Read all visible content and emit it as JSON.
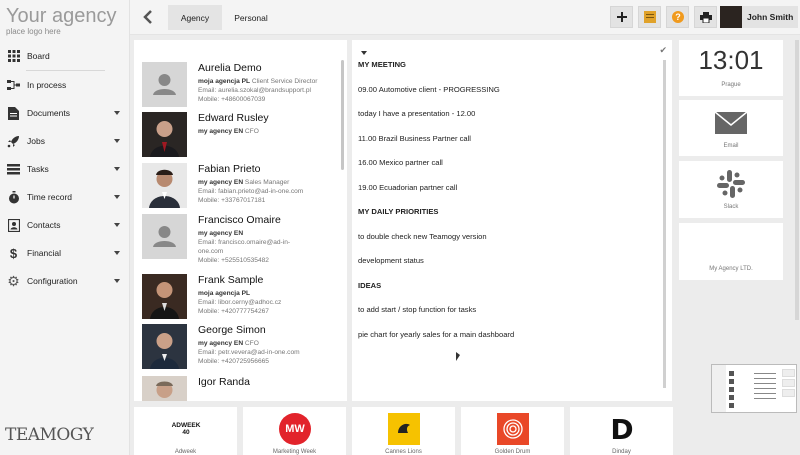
{
  "brand": {
    "title": "Your agency",
    "subtitle": "place logo here",
    "footer_logo": "TEAMOGY"
  },
  "sidebar": {
    "items": [
      {
        "label": "Board",
        "icon": "grid-icon",
        "has_caret": false
      },
      {
        "label": "In process",
        "icon": "flow-icon",
        "has_caret": false
      },
      {
        "label": "Documents",
        "icon": "document-icon",
        "has_caret": true
      },
      {
        "label": "Jobs",
        "icon": "rocket-icon",
        "has_caret": true
      },
      {
        "label": "Tasks",
        "icon": "tasks-icon",
        "has_caret": true
      },
      {
        "label": "Time record",
        "icon": "stopwatch-icon",
        "has_caret": true
      },
      {
        "label": "Contacts",
        "icon": "contact-card-icon",
        "has_caret": true
      },
      {
        "label": "Financial",
        "icon": "dollar-icon",
        "has_caret": true
      },
      {
        "label": "Configuration",
        "icon": "gear-icon",
        "has_caret": true
      }
    ]
  },
  "topbar": {
    "tabs": [
      {
        "label": "Agency",
        "active": true
      },
      {
        "label": "Personal",
        "active": false
      }
    ],
    "user_name": "John Smith"
  },
  "contacts": [
    {
      "name": "Aurelia Demo",
      "company": "moja agencja PL",
      "role": "Client Service Director",
      "lines": [
        "Email: aurelia.szokal@brandsupport.pl",
        "Mobile: +48600067039"
      ],
      "photo": "placeholder"
    },
    {
      "name": "Edward Rusley",
      "company": "my agency EN",
      "role": "CFO",
      "lines": [],
      "photo": "portrait"
    },
    {
      "name": "Fabian Prieto",
      "company": "my agency EN",
      "role": "Sales Manager",
      "lines": [
        "Email: fabian.prieto@ad-in-one.com",
        "Mobile: +33767017181"
      ],
      "photo": "portrait"
    },
    {
      "name": "Francisco Omaire",
      "company": "my agency EN",
      "role": "",
      "lines": [
        "Email: francisco.omaire@ad-in-",
        "one.com",
        "Mobile: +525510535482"
      ],
      "photo": "placeholder"
    },
    {
      "name": "Frank Sample",
      "company": "moja agencja PL",
      "role": "",
      "lines": [
        "Email: libor.cerny@adhoc.cz",
        "Mobile: +420777754267"
      ],
      "photo": "portrait"
    },
    {
      "name": "George Simon",
      "company": "my agency EN",
      "role": "CFO",
      "lines": [
        "Email: petr.vevera@ad-in-one.com",
        "Mobile: +420725956665"
      ],
      "photo": "portrait"
    },
    {
      "name": "Igor Randa",
      "company": "",
      "role": "",
      "lines": [],
      "photo": "portrait"
    }
  ],
  "notes": [
    {
      "text": "MY MEETING",
      "heading": true
    },
    {
      "text": "09.00 Automotive client - PROGRESSING",
      "heading": false
    },
    {
      "text": "today I have a presentation - 12.00",
      "heading": false
    },
    {
      "text": "11.00 Brazil Business Partner call",
      "heading": false
    },
    {
      "text": "16.00 Mexico partner call",
      "heading": false
    },
    {
      "text": "19.00 Ecuadorian partner call",
      "heading": false
    },
    {
      "text": "MY DAILY PRIORITIES",
      "heading": true
    },
    {
      "text": "to double check new Teamogy version",
      "heading": false
    },
    {
      "text": "development status",
      "heading": false
    },
    {
      "text": "IDEAS",
      "heading": true
    },
    {
      "text": "to add start / stop function  for tasks",
      "heading": false
    },
    {
      "text": "pie chart for yearly sales for a main dashboard",
      "heading": false
    }
  ],
  "widgets": {
    "clock": {
      "time": "13:01",
      "city": "Prague"
    },
    "email": {
      "label": "Email"
    },
    "slack": {
      "label": "Slack"
    },
    "agency": {
      "label": "My Agency LTD."
    }
  },
  "bottom_logos": [
    {
      "label": "Adweek",
      "mark": "ADWEEK 40"
    },
    {
      "label": "Marketing Week",
      "mark": "MW"
    },
    {
      "label": "Cannes Lions",
      "mark": ""
    },
    {
      "label": "Golden Drum",
      "mark": ""
    },
    {
      "label": "Dinday",
      "mark": "D"
    }
  ],
  "colors": {
    "accent_red": "#e2232b",
    "background": "#ececec",
    "panel": "#ffffff"
  }
}
